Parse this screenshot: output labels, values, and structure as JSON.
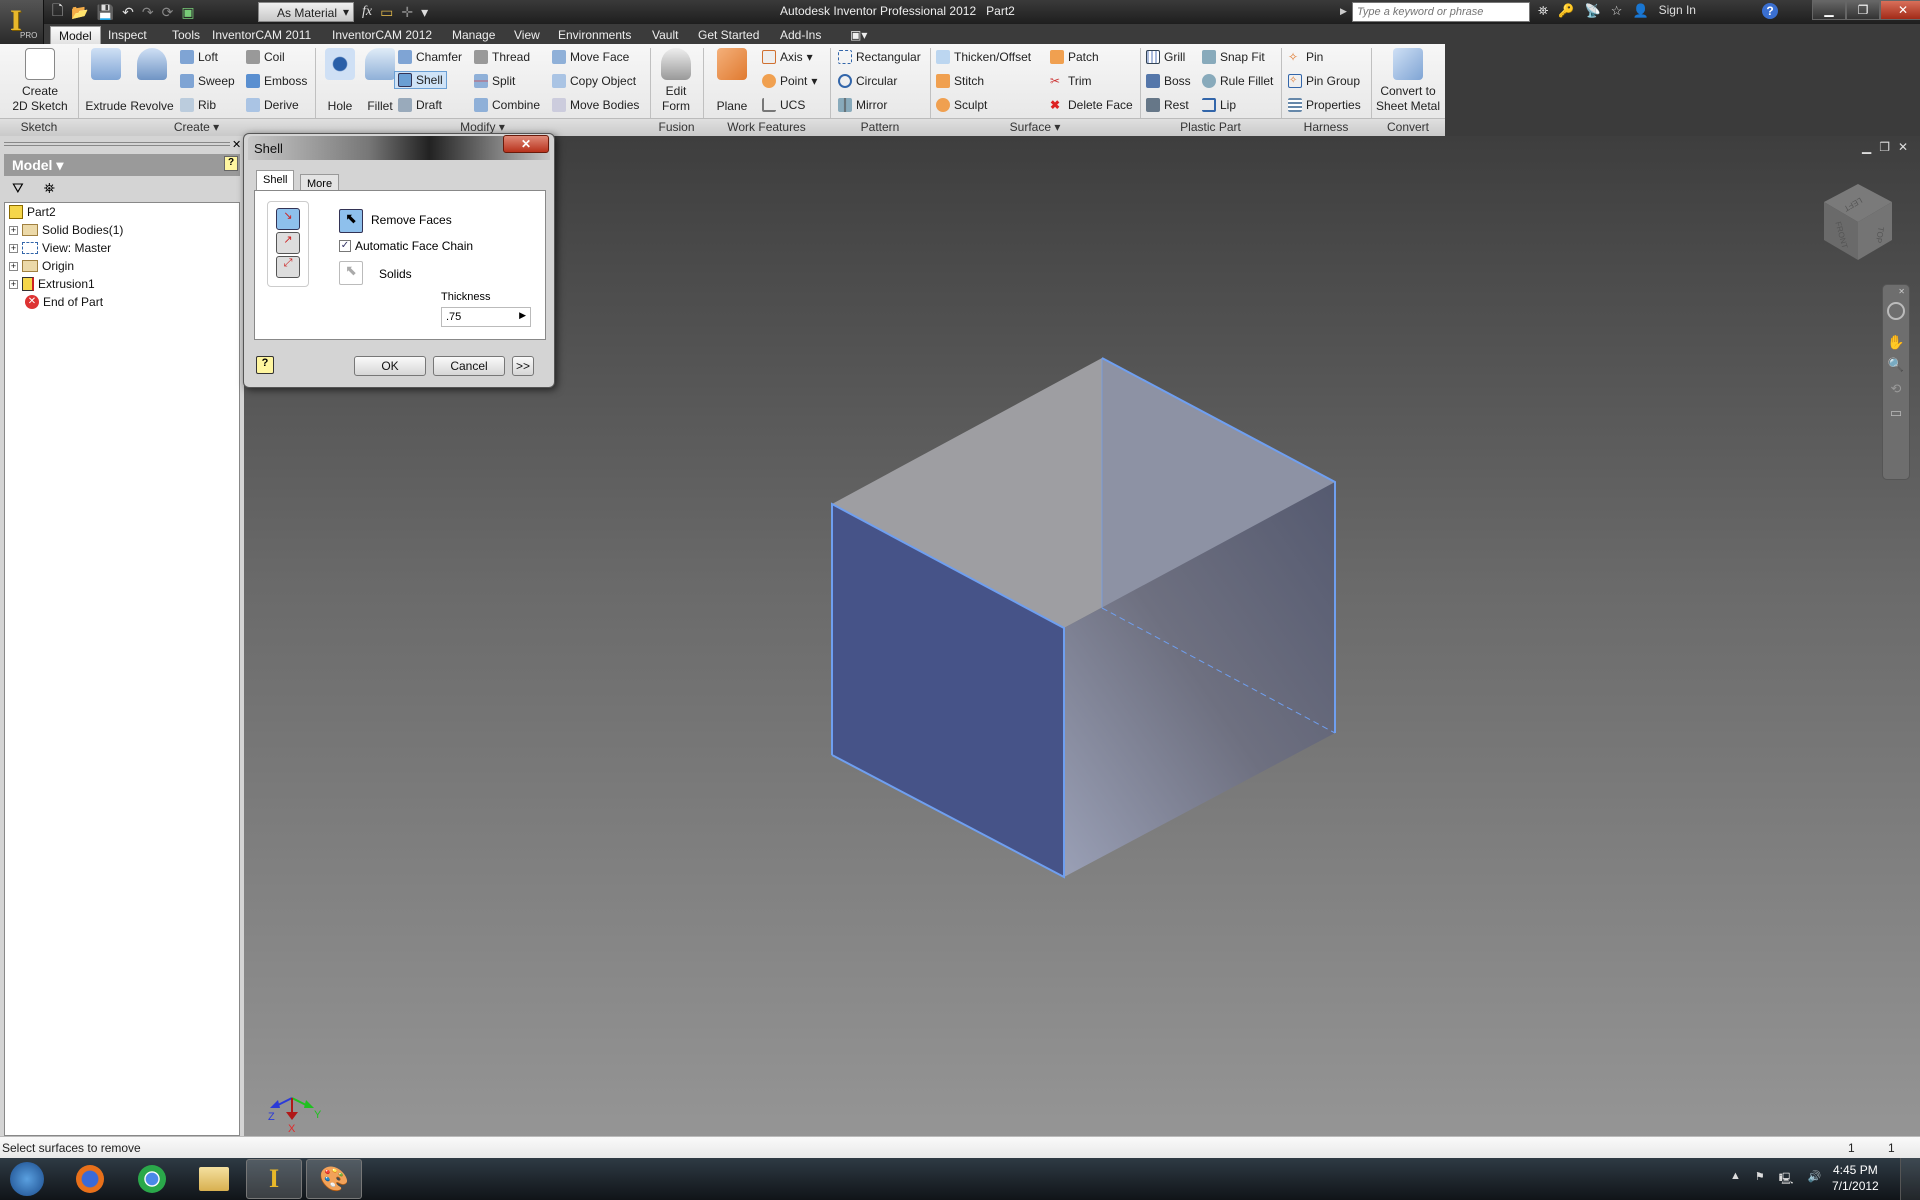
{
  "titlebar": {
    "app_title": "Autodesk Inventor Professional 2012",
    "document": "Part2",
    "material": "As Material",
    "search_placeholder": "Type a keyword or phrase",
    "sign_in": "Sign In",
    "app_badge": "PRO"
  },
  "tabs": [
    "Model",
    "Inspect",
    "Tools",
    "InventorCAM 2011",
    "InventorCAM 2012",
    "Manage",
    "View",
    "Environments",
    "Vault",
    "Get Started",
    "Add-Ins"
  ],
  "ribbon": {
    "panels": [
      "Sketch",
      "Create ▾",
      "Modify ▾",
      "Fusion",
      "Work Features",
      "Pattern",
      "Surface ▾",
      "Plastic Part",
      "Harness",
      "Convert"
    ],
    "sketch": {
      "create_2d_sketch": [
        "Create",
        "2D Sketch"
      ]
    },
    "create": {
      "extrude": "Extrude",
      "revolve": "Revolve",
      "loft": "Loft",
      "sweep": "Sweep",
      "rib": "Rib",
      "coil": "Coil",
      "emboss": "Emboss",
      "derive": "Derive"
    },
    "modify": {
      "hole": "Hole",
      "fillet": "Fillet",
      "chamfer": "Chamfer",
      "shell": "Shell",
      "draft": "Draft",
      "thread": "Thread",
      "split": "Split",
      "combine": "Combine",
      "move_face": "Move Face",
      "copy_object": "Copy Object",
      "move_bodies": "Move Bodies"
    },
    "fusion": {
      "edit_form": [
        "Edit",
        "Form"
      ]
    },
    "work_features": {
      "plane": "Plane",
      "axis": "Axis",
      "point": "Point",
      "ucs": "UCS"
    },
    "pattern": {
      "rectangular": "Rectangular",
      "circular": "Circular",
      "mirror": "Mirror"
    },
    "surface": {
      "thicken": "Thicken/Offset",
      "stitch": "Stitch",
      "sculpt": "Sculpt",
      "patch": "Patch",
      "trim": "Trim",
      "delete_face": "Delete Face"
    },
    "plastic": {
      "grill": "Grill",
      "boss": "Boss",
      "rest": "Rest",
      "snap_fit": "Snap Fit",
      "rule_fillet": "Rule Fillet",
      "lip": "Lip"
    },
    "harness": {
      "pin": "Pin",
      "pin_group": "Pin Group",
      "properties": "Properties"
    },
    "convert": {
      "sheet_metal": [
        "Convert to",
        "Sheet Metal"
      ]
    }
  },
  "browser": {
    "header": "Model ▾",
    "tree": [
      {
        "label": "Part2",
        "expandable": false
      },
      {
        "label": "Solid Bodies(1)",
        "expandable": true
      },
      {
        "label": "View: Master",
        "expandable": true
      },
      {
        "label": "Origin",
        "expandable": true
      },
      {
        "label": "Extrusion1",
        "expandable": true
      },
      {
        "label": "End of Part",
        "expandable": false
      }
    ]
  },
  "dialog": {
    "title": "Shell",
    "tabs": [
      "Shell",
      "More"
    ],
    "remove_faces": "Remove Faces",
    "auto_face_chain": "Automatic Face Chain",
    "auto_face_chain_checked": true,
    "solids": "Solids",
    "thickness_label": "Thickness",
    "thickness_value": ".75",
    "ok": "OK",
    "cancel": "Cancel",
    "more": ">>"
  },
  "viewcube": {
    "faces": [
      "LEFT",
      "FRONT",
      "TOP"
    ]
  },
  "triad": {
    "x": "X",
    "y": "Y",
    "z": "Z"
  },
  "status": {
    "message": "Select surfaces to remove",
    "count1": "1",
    "count2": "1"
  },
  "taskbar": {
    "time": "4:45 PM",
    "date": "7/1/2012"
  },
  "colors": {
    "selection": "#6f9ff0",
    "selected_face": "#465388",
    "dialog_close": "#c0442c"
  }
}
